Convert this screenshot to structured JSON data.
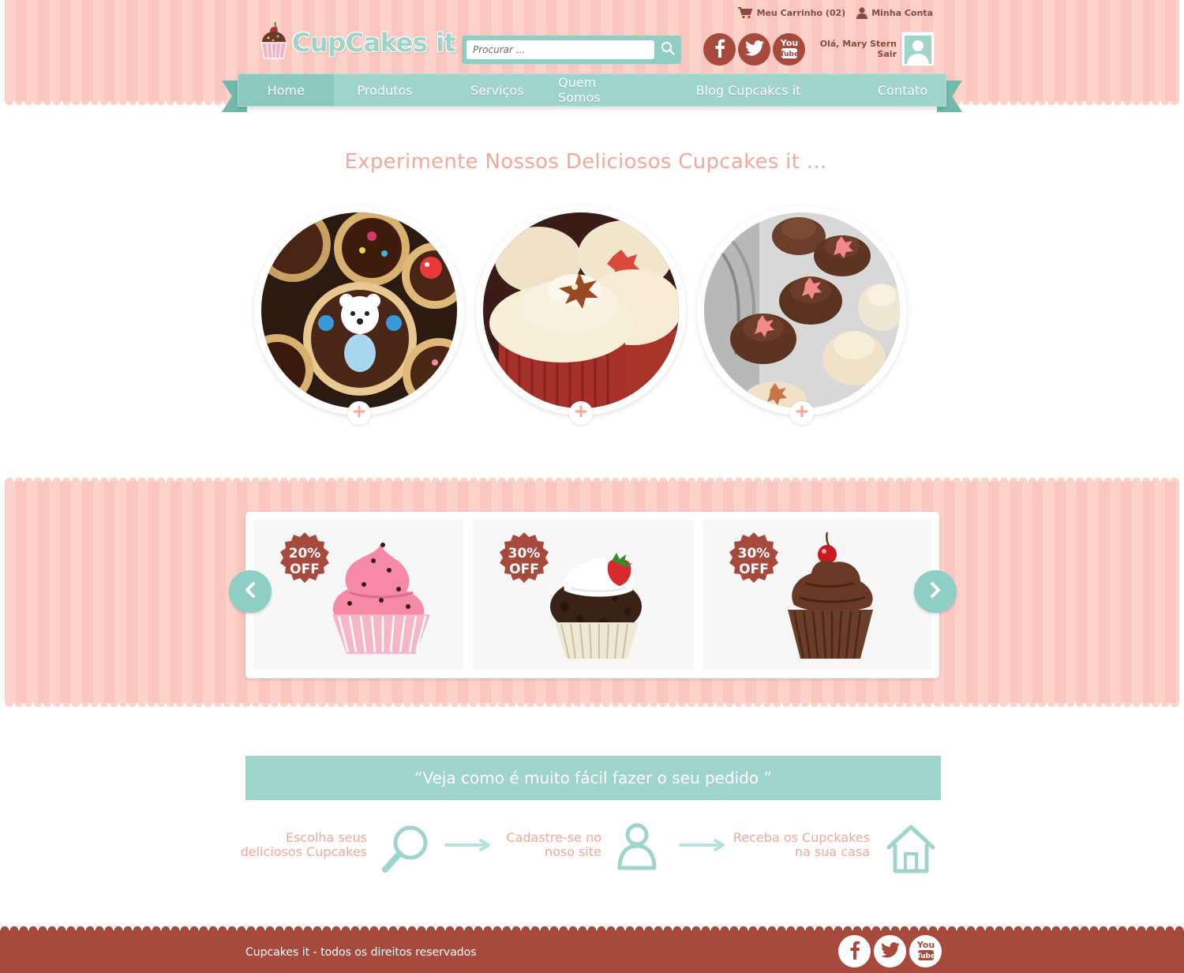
{
  "header": {
    "cart_label": "Meu Carrinho (02)",
    "account_label": "Minha Conta",
    "logo_text": "CupCakes it",
    "search_placeholder": "Procurar ...",
    "greeting": "Olá, Mary Stern",
    "logout_label": "Sair"
  },
  "nav": {
    "items": [
      {
        "label": "Home",
        "active": true
      },
      {
        "label": "Produtos"
      },
      {
        "label": "Serviços"
      },
      {
        "label": "Quem Somos"
      },
      {
        "label": "Blog Cupcakcs it"
      },
      {
        "label": "Contato"
      }
    ]
  },
  "hero": {
    "title": "Experimente Nossos Deliciosos Cupcakes it ..."
  },
  "promos": [
    {
      "line1": "20%",
      "line2": "OFF"
    },
    {
      "line1": "30%",
      "line2": "OFF"
    },
    {
      "line1": "30%",
      "line2": "OFF"
    }
  ],
  "steps": {
    "banner": "“Veja como é muito fácil fazer o seu pedido ”",
    "items": [
      {
        "line1": "Escolha seus",
        "line2": "deliciosos Cupcakes"
      },
      {
        "line1": "Cadastre-se no",
        "line2": "noso site"
      },
      {
        "line1": "Receba os Cupckakes",
        "line2": "na sua  casa"
      }
    ]
  },
  "footer": {
    "copyright": "Cupcakes it - todos os direitos reservados"
  },
  "colors": {
    "pink_band": "#fcd2cb",
    "teal": "#9fd4cb",
    "brown": "#a64a3e",
    "salmon_text": "#f4a899"
  }
}
